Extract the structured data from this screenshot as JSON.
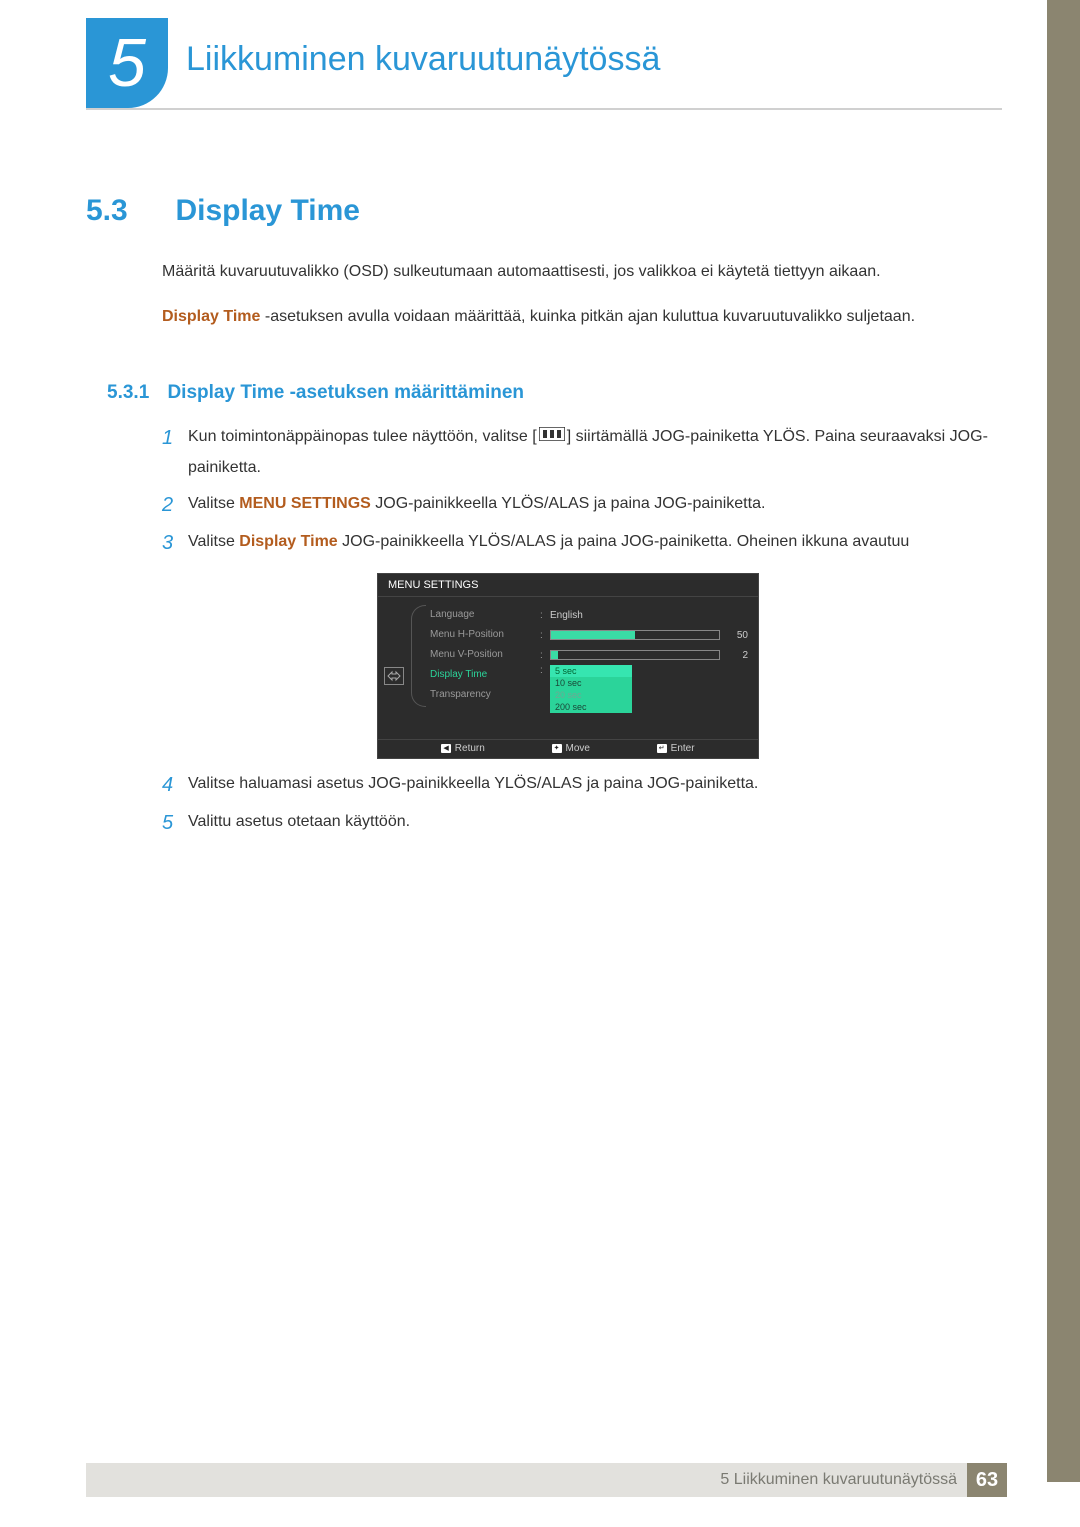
{
  "chapter": {
    "num": "5",
    "title": "Liikkuminen kuvaruutunäytössä"
  },
  "section": {
    "num": "5.3",
    "title": "Display Time"
  },
  "intro": {
    "p1": "Määritä kuvaruutuvalikko (OSD) sulkeutumaan automaattisesti, jos valikkoa ei käytetä tiettyyn aikaan.",
    "p2_hl": "Display Time",
    "p2_rest": " -asetuksen avulla voidaan määrittää, kuinka pitkän ajan kuluttua kuvaruutuvalikko suljetaan."
  },
  "subsection": {
    "num": "5.3.1",
    "title": "Display Time -asetuksen määrittäminen"
  },
  "steps": {
    "s1": {
      "n": "1",
      "a": "Kun toimintonäppäinopas tulee näyttöön, valitse [",
      "b": "] siirtämällä JOG-painiketta YLÖS. Paina seuraavaksi JOG-painiketta."
    },
    "s2": {
      "n": "2",
      "a": "Valitse ",
      "hl": "MENU SETTINGS",
      "b": " JOG-painikkeella YLÖS/ALAS ja paina JOG-painiketta."
    },
    "s3": {
      "n": "3",
      "a": "Valitse ",
      "hl": "Display Time",
      "b": " JOG-painikkeella YLÖS/ALAS ja paina JOG-painiketta. Oheinen ikkuna avautuu"
    },
    "s4": {
      "n": "4",
      "t": "Valitse haluamasi asetus JOG-painikkeella YLÖS/ALAS ja paina JOG-painiketta."
    },
    "s5": {
      "n": "5",
      "t": "Valittu asetus otetaan käyttöön."
    }
  },
  "osd": {
    "title": "MENU SETTINGS",
    "items": {
      "lang": "Language",
      "hpos": "Menu H-Position",
      "vpos": "Menu V-Position",
      "dtime": "Display Time",
      "trans": "Transparency"
    },
    "langval": "English",
    "hval": "50",
    "vval": "2",
    "opts": {
      "a": "5 sec",
      "b": "10 sec",
      "c": "20 sec",
      "d": "200 sec"
    },
    "foot": {
      "ret": "Return",
      "move": "Move",
      "enter": "Enter"
    }
  },
  "footer": {
    "text": "5 Liikkuminen kuvaruutunäytössä",
    "page": "63"
  }
}
